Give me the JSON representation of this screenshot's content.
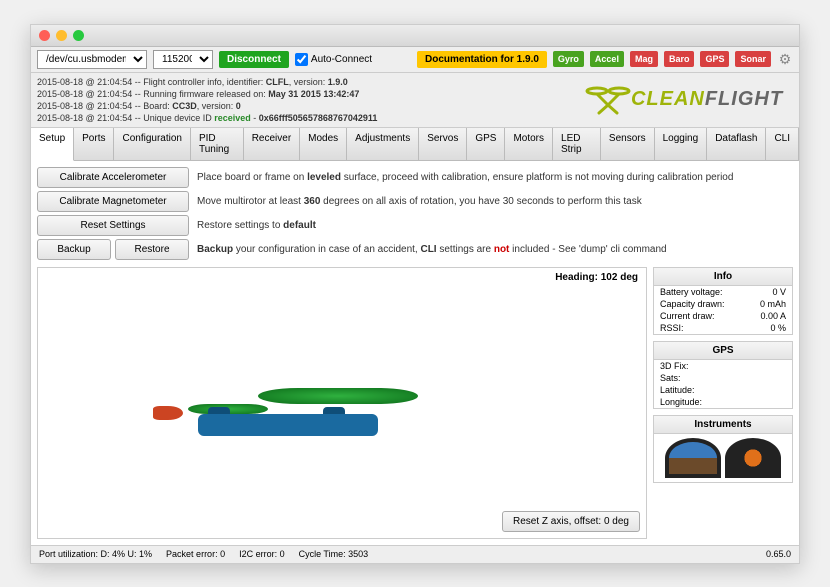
{
  "toolbar": {
    "port": "/dev/cu.usbmodem",
    "baud": "115200",
    "disconnect": "Disconnect",
    "autoconnect": "Auto-Connect",
    "doc": "Documentation for 1.9.0",
    "indicators": {
      "gyro": "Gyro",
      "accel": "Accel",
      "mag": "Mag",
      "baro": "Baro",
      "gps": "GPS",
      "sonar": "Sonar"
    }
  },
  "log": {
    "l1_pre": "2015-08-18 @ 21:04:54 -- Flight controller info, identifier: ",
    "l1_b1": "CLFL",
    "l1_mid": ", version: ",
    "l1_b2": "1.9.0",
    "l2_pre": "2015-08-18 @ 21:04:54 -- Running firmware released on: ",
    "l2_b": "May 31 2015 13:42:47",
    "l3_pre": "2015-08-18 @ 21:04:54 -- Board: ",
    "l3_b1": "CC3D",
    "l3_mid": ", version: ",
    "l3_b2": "0",
    "l4_pre": "2015-08-18 @ 21:04:54 -- Unique device ID ",
    "l4_rec": "received",
    "l4_mid": " - ",
    "l4_b": "0x66fff505657868767042911"
  },
  "logo": {
    "c": "CLEAN",
    "f": "FLIGHT"
  },
  "tabs": [
    "Setup",
    "Ports",
    "Configuration",
    "PID Tuning",
    "Receiver",
    "Modes",
    "Adjustments",
    "Servos",
    "GPS",
    "Motors",
    "LED Strip",
    "Sensors",
    "Logging",
    "Dataflash",
    "CLI"
  ],
  "buttons": {
    "cal_accel": "Calibrate Accelerometer",
    "cal_mag": "Calibrate Magnetometer",
    "reset": "Reset Settings",
    "backup": "Backup",
    "restore": "Restore",
    "reset_z": "Reset Z axis, offset: 0 deg"
  },
  "desc": {
    "d1a": "Place board or frame on ",
    "d1b": "leveled",
    "d1c": " surface, proceed with calibration, ensure platform is not moving during calibration period",
    "d2a": "Move multirotor at least ",
    "d2b": "360",
    "d2c": " degrees on all axis of rotation, you have 30 seconds to perform this task",
    "d3a": "Restore settings to ",
    "d3b": "default",
    "d4a": "Backup",
    "d4b": " your configuration in case of an accident, ",
    "d4c": "CLI",
    "d4d": " settings are ",
    "d4not": "not",
    "d4e": " included - See 'dump' cli command"
  },
  "heading": "Heading: 102 deg",
  "panels": {
    "info": {
      "title": "Info",
      "battery_k": "Battery voltage:",
      "battery_v": "0 V",
      "capacity_k": "Capacity drawn:",
      "capacity_v": "0 mAh",
      "current_k": "Current draw:",
      "current_v": "0.00 A",
      "rssi_k": "RSSI:",
      "rssi_v": "0 %"
    },
    "gps": {
      "title": "GPS",
      "fix_k": "3D Fix:",
      "fix_v": "",
      "sats_k": "Sats:",
      "sats_v": "",
      "lat_k": "Latitude:",
      "lat_v": "",
      "lon_k": "Longitude:",
      "lon_v": ""
    },
    "instruments": {
      "title": "Instruments"
    }
  },
  "status": {
    "port": "Port utilization: D: 4% U: 1%",
    "packet": "Packet error: 0",
    "i2c": "I2C error: 0",
    "cycle": "Cycle Time: 3503",
    "version": "0.65.0"
  }
}
